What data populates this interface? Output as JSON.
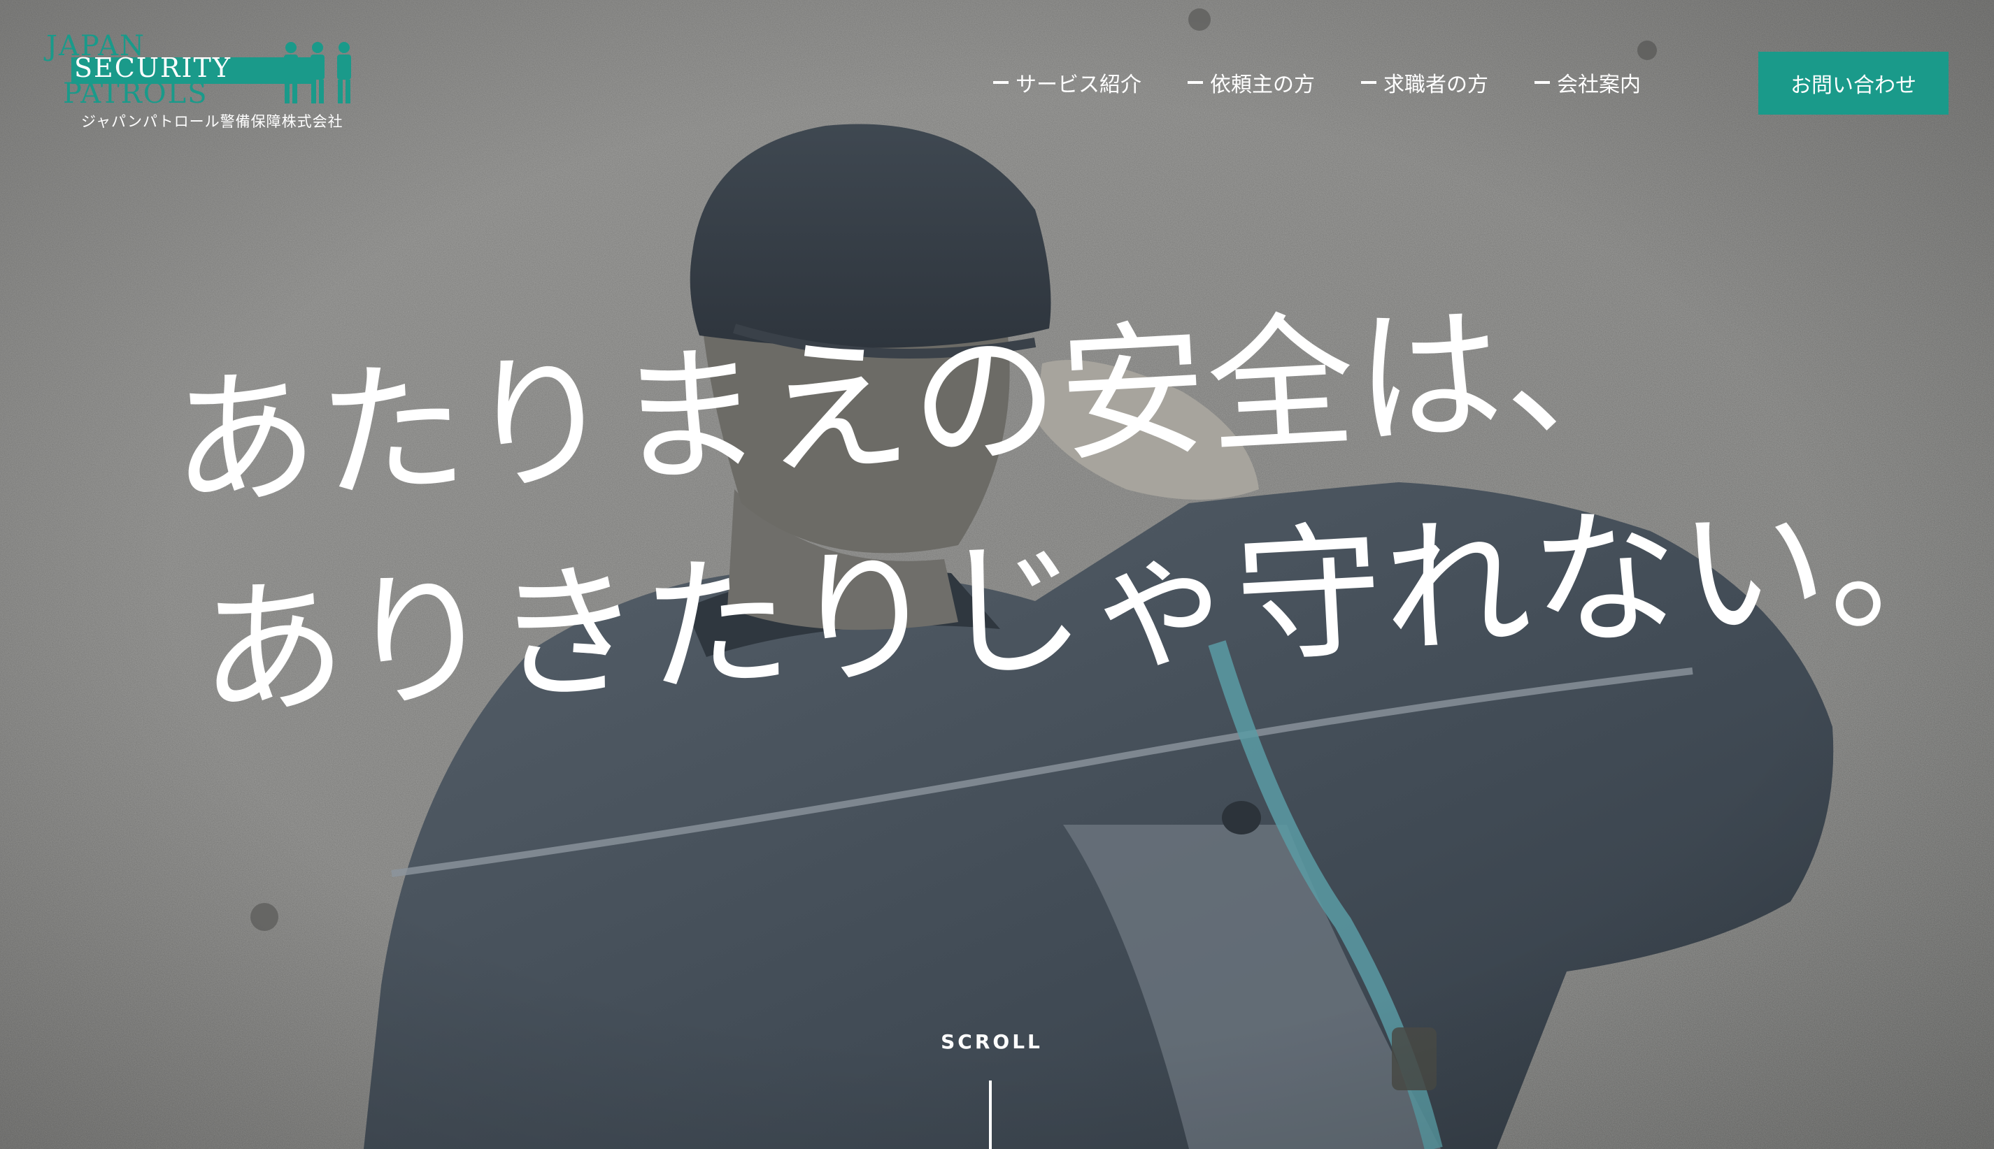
{
  "brand": {
    "logo_word_1": "JAPAN",
    "logo_word_2": "SECURITY",
    "logo_word_3": "PATROLS",
    "company_name": "ジャパンパトロール警備保障株式会社",
    "accent_color": "#1a9a8a"
  },
  "nav": {
    "items": [
      {
        "label": "サービス紹介"
      },
      {
        "label": "依頼主の方"
      },
      {
        "label": "求職者の方"
      },
      {
        "label": "会社案内"
      }
    ],
    "contact_label": "お問い合わせ"
  },
  "hero": {
    "headline_line1": "あたりまえの安全は、",
    "headline_line2": "ありきたりじゃ守れない。",
    "scroll_label": "SCROLL"
  },
  "icons": {
    "logo_figures": "security-guard-figures-icon",
    "nav_marker": "dash-icon"
  }
}
